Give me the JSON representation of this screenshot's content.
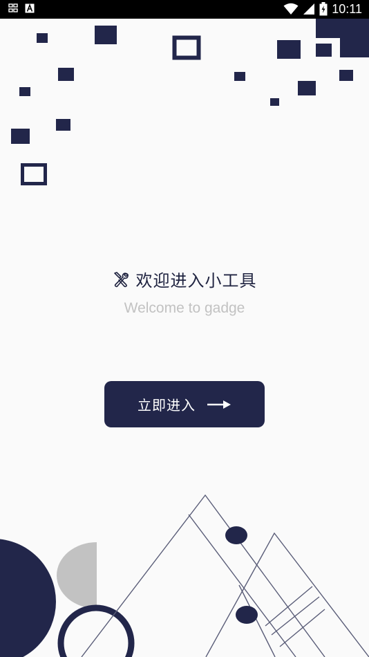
{
  "status_bar": {
    "time": "10:11",
    "left_icons": [
      "grid-notification-icon",
      "a-notification-icon"
    ],
    "right_icons": [
      "wifi-icon",
      "cell-signal-icon",
      "battery-icon"
    ]
  },
  "welcome": {
    "title": "欢迎进入小工具",
    "title_icon": "tools-icon",
    "subtitle": "Welcome to gadge"
  },
  "enter_button": {
    "label": "立即进入",
    "icon": "arrow-right-icon"
  },
  "colors": {
    "navy": "#22264a",
    "background": "#fafafa",
    "subtitle": "#c2c2c2",
    "gray_shape": "#c2c2c2",
    "line": "#5a5d78"
  }
}
